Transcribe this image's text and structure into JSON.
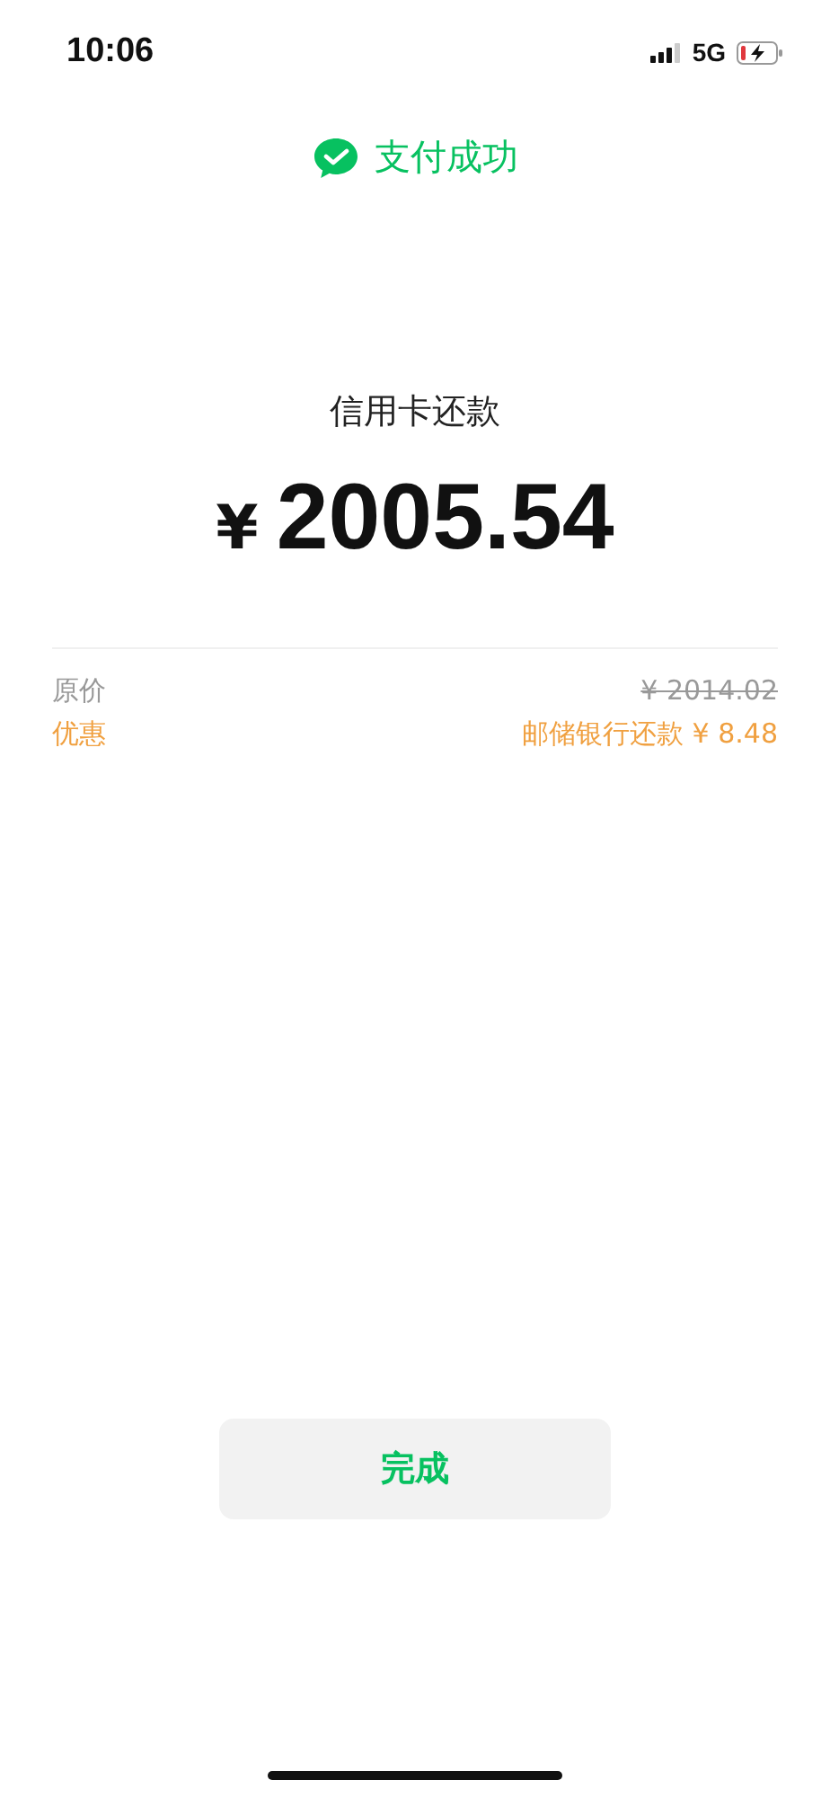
{
  "status_bar": {
    "time": "10:06",
    "network": "5G"
  },
  "header": {
    "title": "支付成功"
  },
  "payment": {
    "label": "信用卡还款",
    "currency": "¥",
    "amount": "2005.54"
  },
  "details": [
    {
      "kind": "original",
      "label": "原价",
      "value": "¥ 2014.02"
    },
    {
      "kind": "discount",
      "label": "优惠",
      "value": "邮储银行还款 ¥ 8.48"
    }
  ],
  "done_button": {
    "label": "完成"
  }
}
